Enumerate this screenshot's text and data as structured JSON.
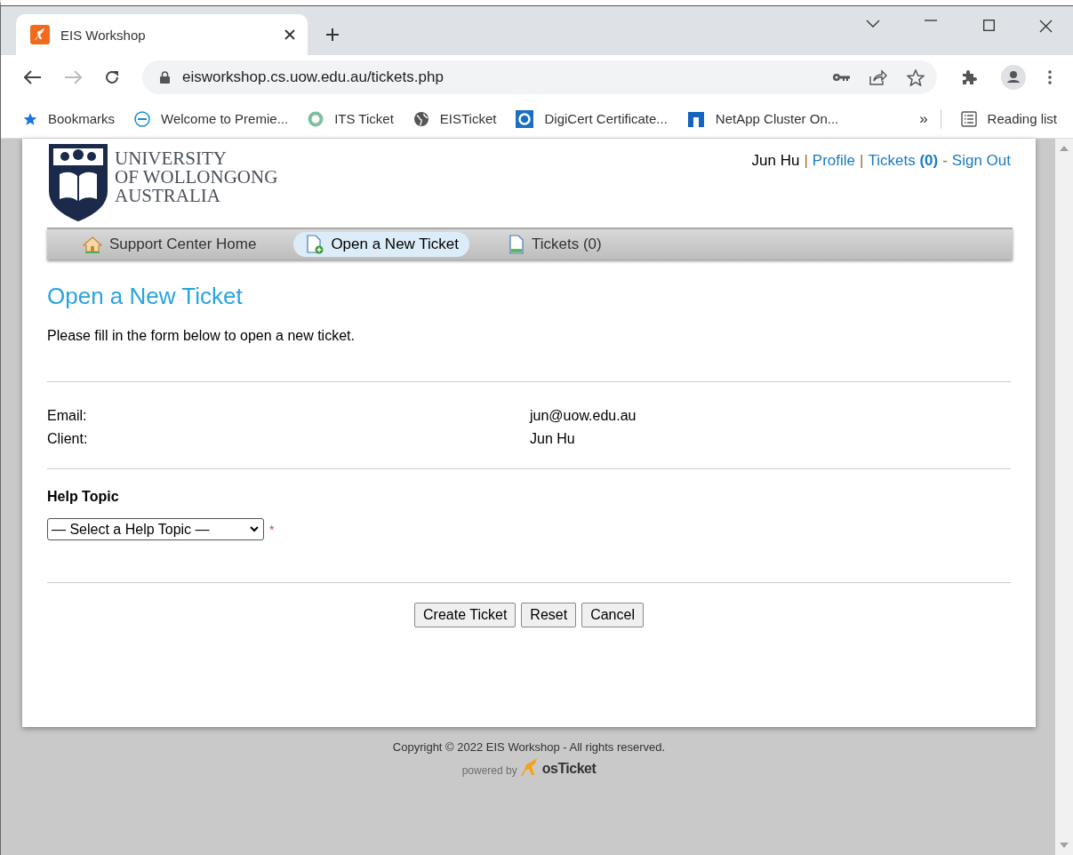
{
  "browser": {
    "tabs": [
      {
        "title": "EIS Workshop",
        "selected": true
      }
    ],
    "address": "eisworkshop.cs.uow.edu.au/tickets.php",
    "forward_disabled": true,
    "bookmarks": [
      {
        "label": "Bookmarks",
        "kind": "star"
      },
      {
        "label": "Welcome to Premie...",
        "kind": "dell"
      },
      {
        "label": "ITS Ticket",
        "kind": "ring"
      },
      {
        "label": "EISTicket",
        "kind": "globe"
      },
      {
        "label": "DigiCert Certificate...",
        "kind": "digicert"
      },
      {
        "label": "NetApp Cluster On...",
        "kind": "netapp"
      }
    ],
    "overflow": "»",
    "reading_list": "Reading list"
  },
  "header": {
    "logo_lines": [
      "UNIVERSITY",
      "OF WOLLONGONG",
      "AUSTRALIA"
    ],
    "user_nav": [
      {
        "text": "Jun Hu",
        "kind": "name"
      },
      {
        "text": "|",
        "kind": "sep"
      },
      {
        "text": "Profile",
        "kind": "link"
      },
      {
        "text": "|",
        "kind": "sep"
      },
      {
        "text": "Tickets **(0)**",
        "kind": "link"
      },
      {
        "text": "-",
        "kind": "sep"
      },
      {
        "text": "Sign Out",
        "kind": "link"
      }
    ]
  },
  "nav": [
    {
      "label": "Support Center Home",
      "kind": "home",
      "selected": false
    },
    {
      "label": "Open a New Ticket",
      "kind": "new",
      "selected": true
    },
    {
      "label": "Tickets (0)",
      "kind": "list",
      "selected": false
    }
  ],
  "page": {
    "title": "Open a New Ticket",
    "intro": "Please fill in the form below to open a new ticket.",
    "info": [
      {
        "label": "Email:",
        "value": "jun@uow.edu.au"
      },
      {
        "label": "Client:",
        "value": "Jun Hu"
      }
    ],
    "help_topic": {
      "label": "Help Topic",
      "value": "— Select a Help Topic —",
      "required_mark": "*"
    },
    "buttons": [
      "Create Ticket",
      "Reset",
      "Cancel"
    ]
  },
  "footer": {
    "copyright": "Copyright © 2022 EIS Workshop - All rights reserved.",
    "powered_by": "powered by",
    "brand": "osTicket"
  }
}
